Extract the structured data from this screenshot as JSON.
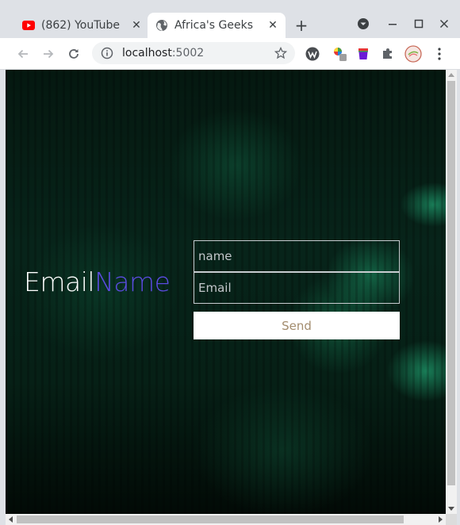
{
  "browser": {
    "tabs": [
      {
        "title": "(862) YouTube",
        "favicon": "youtube-icon",
        "active": false
      },
      {
        "title": "Africa's Geeks",
        "favicon": "globe-icon",
        "active": true
      }
    ],
    "close_glyph": "✕",
    "new_tab_glyph": "+",
    "url_host": "localhost",
    "url_port": ":5002"
  },
  "page": {
    "brand_white": "Email",
    "brand_accent": "Name",
    "name_placeholder": "name",
    "email_placeholder": "Email",
    "send_label": "Send"
  },
  "colors": {
    "accent": "#5b4be0",
    "send_text": "#a38c6e",
    "background": "#062016"
  }
}
